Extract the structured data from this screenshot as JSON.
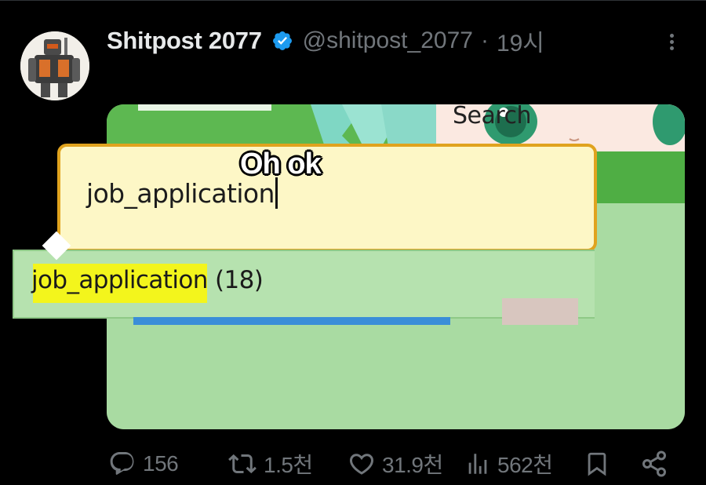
{
  "post": {
    "author_name": "Shitpost 2077",
    "handle": "@shitpost_2077",
    "separator": "·",
    "time": "19시"
  },
  "media": {
    "search_label": "Search",
    "search_value": "job_application",
    "overlay_caption": "Oh ok",
    "suggestion_match": "job_application",
    "suggestion_count": "(18)"
  },
  "actions": {
    "replies": "156",
    "reposts": "1.5천",
    "likes": "31.9천",
    "views": "562천"
  },
  "colors": {
    "background": "#000000",
    "text": "#e7e9ea",
    "muted": "#71767b",
    "verified": "#1d9bf0"
  },
  "icons": [
    "verified-badge-icon",
    "more-options-icon",
    "reply-icon",
    "repost-icon",
    "like-icon",
    "views-icon",
    "bookmark-icon",
    "share-icon"
  ]
}
